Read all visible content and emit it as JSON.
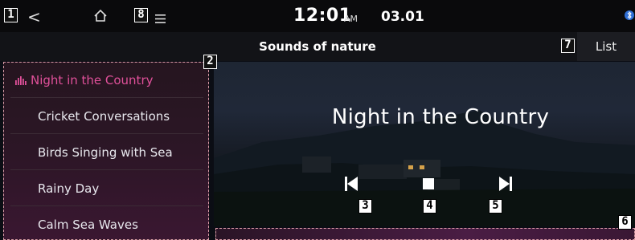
{
  "status_bar": {
    "time": "12:01",
    "ampm": "AM",
    "date": "03.01",
    "icons": [
      "back-icon",
      "home-icon",
      "menu-icon",
      "bluetooth-icon"
    ]
  },
  "header": {
    "title": "Sounds of nature",
    "list_label": "List"
  },
  "playlist": {
    "items": [
      {
        "label": "Night in the Country",
        "active": true
      },
      {
        "label": "Cricket Conversations",
        "active": false
      },
      {
        "label": "Birds Singing with Sea",
        "active": false
      },
      {
        "label": "Rainy Day",
        "active": false
      },
      {
        "label": "Calm Sea Waves",
        "active": false
      }
    ]
  },
  "player": {
    "now_playing": "Night in the Country",
    "controls": [
      "previous-icon",
      "stop-icon",
      "next-icon"
    ]
  },
  "callouts": {
    "c1": "1",
    "c2": "2",
    "c3": "3",
    "c4": "4",
    "c5": "5",
    "c6": "6",
    "c7": "7",
    "c8": "8"
  },
  "colors": {
    "accent": "#e0509a",
    "status_bar": "#0a0a0c",
    "title_bar": "#121317"
  }
}
